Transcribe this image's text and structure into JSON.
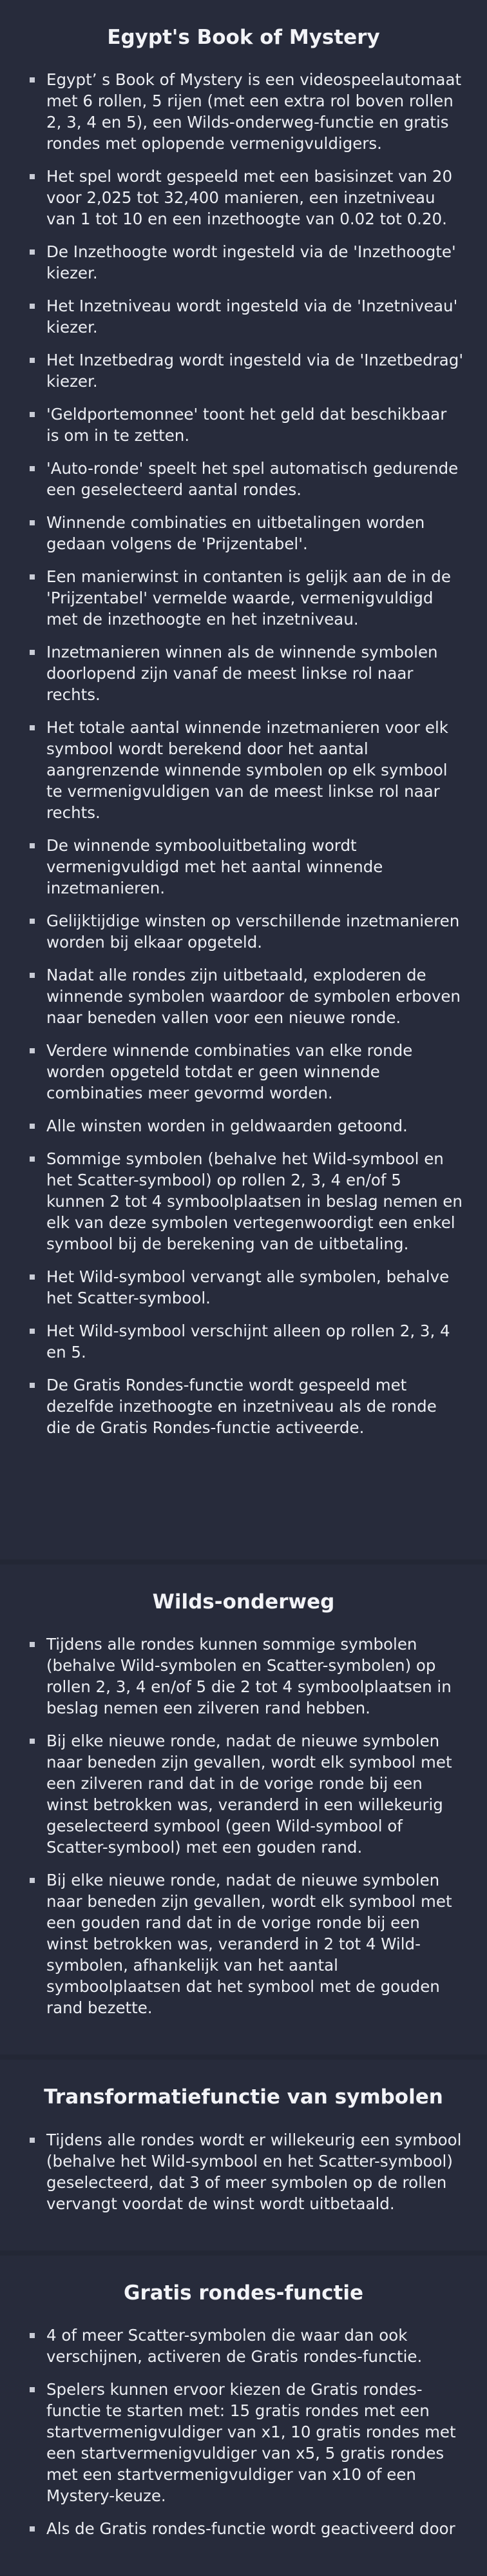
{
  "sections": [
    {
      "title": "Egypt's Book of Mystery",
      "items": [
        "Egypt’ s Book of Mystery is een videospeelautomaat met 6 rollen, 5 rijen (met een extra rol boven rollen 2, 3, 4 en 5), een Wilds-onderweg-functie en gratis rondes met oplopende vermenigvuldigers.",
        "Het spel wordt gespeeld met een basisinzet van 20 voor 2,025 tot 32,400 manieren, een inzetniveau van 1 tot 10 en een inzethoogte van 0.02 tot 0.20.",
        "De Inzethoogte wordt ingesteld via de 'Inzethoogte' kiezer.",
        "Het Inzetniveau wordt ingesteld via de 'Inzetniveau' kiezer.",
        "Het Inzetbedrag wordt ingesteld via de 'Inzetbedrag' kiezer.",
        "'Geldportemonnee' toont het geld dat beschikbaar is om in te zetten.",
        "'Auto-ronde' speelt het spel automatisch gedurende een geselecteerd aantal rondes.",
        "Winnende combinaties en uitbetalingen worden gedaan volgens de 'Prijzentabel'.",
        "Een manierwinst in contanten is gelijk aan de in de 'Prijzentabel' vermelde waarde, vermenigvuldigd met de inzethoogte en het inzetniveau.",
        "Inzetmanieren winnen als de winnende symbolen doorlopend zijn vanaf de meest linkse rol naar rechts.",
        "Het totale aantal winnende inzetmanieren voor elk symbool wordt berekend door het aantal aangrenzende winnende symbolen op elk symbool te vermenigvuldigen van de meest linkse rol naar rechts.",
        "De winnende symbooluitbetaling wordt vermenigvuldigd met het aantal winnende inzetmanieren.",
        "Gelijktijdige winsten op verschillende inzetmanieren worden bij elkaar opgeteld.",
        "Nadat alle rondes zijn uitbetaald, exploderen de winnende symbolen waardoor de symbolen erboven naar beneden vallen voor een nieuwe ronde.",
        "Verdere winnende combinaties van elke ronde worden opgeteld totdat er geen winnende combinaties meer gevormd worden.",
        "Alle winsten worden in geldwaarden getoond.",
        "Sommige symbolen (behalve het Wild-symbool en het Scatter-symbool) op rollen 2, 3, 4 en/of 5 kunnen 2 tot 4 symboolplaatsen in beslag nemen en elk van deze symbolen vertegenwoordigt een enkel symbool bij de berekening van de uitbetaling.",
        "Het Wild-symbool vervangt alle symbolen, behalve het Scatter-symbool.",
        "Het Wild-symbool verschijnt alleen op rollen 2, 3, 4 en 5.",
        "De Gratis Rondes-functie wordt gespeeld met dezelfde inzethoogte en inzetniveau als de ronde die de Gratis Rondes-functie activeerde."
      ]
    },
    {
      "title": "Wilds-onderweg",
      "items": [
        "Tijdens alle rondes kunnen sommige symbolen (behalve Wild-symbolen en Scatter-symbolen) op rollen 2, 3, 4 en/of 5 die 2 tot 4 symboolplaatsen in beslag nemen een zilveren rand hebben.",
        "Bij elke nieuwe ronde, nadat de nieuwe symbolen naar beneden zijn gevallen, wordt elk symbool met een zilveren rand dat in de vorige ronde bij een winst betrokken was, veranderd in een willekeurig geselecteerd symbool (geen Wild-symbool of Scatter-symbool) met een gouden rand.",
        "Bij elke nieuwe ronde, nadat de nieuwe symbolen naar beneden zijn gevallen, wordt elk symbool met een gouden rand dat in de vorige ronde bij een winst betrokken was, veranderd in 2 tot 4 Wild-symbolen, afhankelijk van het aantal symboolplaatsen dat het symbool met de gouden rand bezette."
      ]
    },
    {
      "title": "Transformatiefunctie van symbolen",
      "items": [
        "Tijdens alle rondes wordt er willekeurig een symbool (behalve het Wild-symbool en het Scatter-symbool) geselecteerd, dat 3 of meer symbolen op de rollen vervangt voordat de winst wordt uitbetaald."
      ]
    },
    {
      "title": "Gratis rondes-functie",
      "items": [
        "4 of meer Scatter-symbolen die waar dan ook verschijnen, activeren de Gratis rondes-functie.",
        "Spelers kunnen ervoor kiezen de Gratis rondes-functie te starten met: 15 gratis rondes met een startvermenigvuldiger van x1, 10 gratis rondes met een startvermenigvuldiger van x5, 5 gratis rondes met een startvermenigvuldiger van x10 of een Mystery-keuze.",
        "Als de Gratis rondes-functie wordt geactiveerd door"
      ]
    }
  ]
}
